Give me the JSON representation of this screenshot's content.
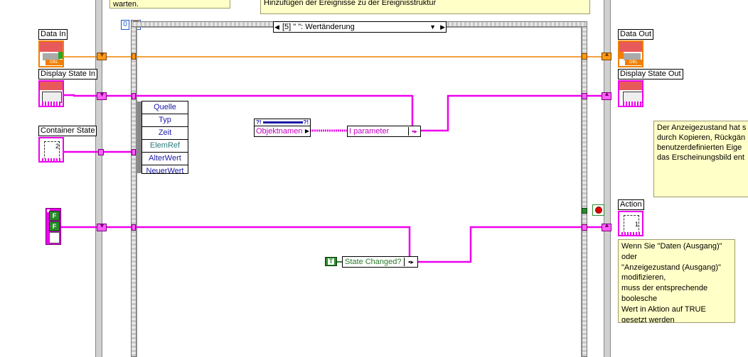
{
  "notes": {
    "top_left_text": "warten.",
    "top_center_text": "Hinzufügen der Ereignisse zu der Ereignisstruktur",
    "right_middle_lines": [
      "Der Anzeigezustand hat s",
      "durch Kopieren, Rückgän",
      "benutzerdefinierten Eige",
      "das Erscheinungsbild ent"
    ],
    "bottom_right_lines": [
      "Wenn Sie \"Daten (Ausgang)\"",
      "oder",
      "\"Anzeigezustand (Ausgang)\"",
      "modifizieren,",
      "muss der entsprechende",
      "boolesche",
      "Wert in Aktion auf TRUE",
      "gesetzt werden"
    ]
  },
  "loop": {
    "iteration_index": "0"
  },
  "event_case": {
    "selector_label": "[5] \"              \": Wertänderung"
  },
  "terminals": {
    "data_in": "Data In",
    "display_state_in": "Display State In",
    "container_state": "Container State",
    "data_out": "Data Out",
    "display_state_out": "Display State Out",
    "action": "Action",
    "dbl_tag": "DBL"
  },
  "event_data_fields": [
    "Quelle",
    "Typ",
    "Zeit",
    "ElemRef",
    "AlterWert",
    "NeuerWert"
  ],
  "nodes": {
    "property_name": "Objektnamen",
    "bundle_parameter": "I      parameter",
    "state_changed": "State Changed?",
    "bool_true": "T",
    "bool_false": "F"
  },
  "colors": {
    "orange_wire": "#f08000",
    "pink_wire": "#ee00ee",
    "green_bool": "#2a8a2a",
    "note_bg": "#ffffc8"
  }
}
